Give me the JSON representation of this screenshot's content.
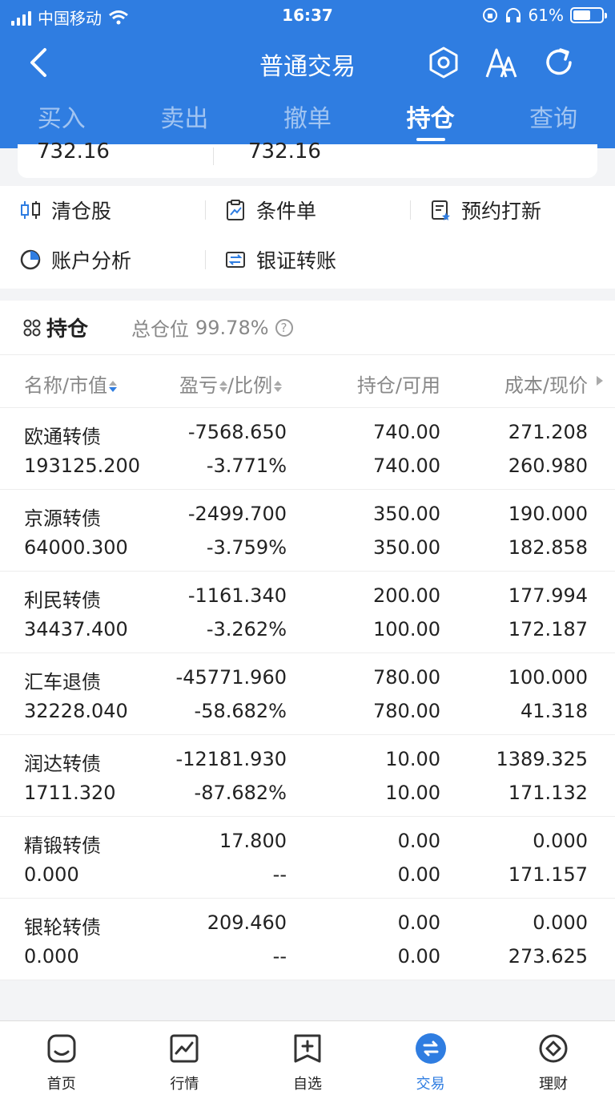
{
  "status": {
    "carrier": "中国移动",
    "time": "16:37",
    "battery": "61%",
    "battery_level": 0.61
  },
  "nav": {
    "title": "普通交易"
  },
  "tabs": [
    {
      "label": "买入"
    },
    {
      "label": "卖出"
    },
    {
      "label": "撤单"
    },
    {
      "label": "持仓",
      "active": true
    },
    {
      "label": "查询"
    }
  ],
  "summary": {
    "left_value": "732.16",
    "right_value": "732.16"
  },
  "quick_actions": [
    "清仓股",
    "条件单",
    "预约打新",
    "账户分析",
    "银证转账"
  ],
  "holdings": {
    "title": "持仓",
    "total_label": "总仓位",
    "total_value": "99.78%",
    "columns": {
      "name": "名称/市值",
      "pl": "盈亏",
      "pl_ratio": "/比例",
      "qty": "持仓/可用",
      "cost": "成本/现价"
    },
    "rows": [
      {
        "name": "欧通转债",
        "market_value": "193125.200",
        "pl": "-7568.650",
        "pl_ratio": "-3.771%",
        "position": "740.00",
        "available": "740.00",
        "cost": "271.208",
        "price": "260.980",
        "sign": "neg"
      },
      {
        "name": "京源转债",
        "market_value": "64000.300",
        "pl": "-2499.700",
        "pl_ratio": "-3.759%",
        "position": "350.00",
        "available": "350.00",
        "cost": "190.000",
        "price": "182.858",
        "sign": "neg"
      },
      {
        "name": "利民转债",
        "market_value": "34437.400",
        "pl": "-1161.340",
        "pl_ratio": "-3.262%",
        "position": "200.00",
        "available": "100.00",
        "cost": "177.994",
        "price": "172.187",
        "sign": "neg"
      },
      {
        "name": "汇车退债",
        "market_value": "32228.040",
        "pl": "-45771.960",
        "pl_ratio": "-58.682%",
        "position": "780.00",
        "available": "780.00",
        "cost": "100.000",
        "price": "41.318",
        "sign": "neg"
      },
      {
        "name": "润达转债",
        "market_value": "1711.320",
        "pl": "-12181.930",
        "pl_ratio": "-87.682%",
        "position": "10.00",
        "available": "10.00",
        "cost": "1389.325",
        "price": "171.132",
        "sign": "neg"
      },
      {
        "name": "精锻转债",
        "market_value": "0.000",
        "pl": "17.800",
        "pl_ratio": "--",
        "position": "0.00",
        "available": "0.00",
        "cost": "0.000",
        "price": "171.157",
        "sign": "pos"
      },
      {
        "name": "银轮转债",
        "market_value": "0.000",
        "pl": "209.460",
        "pl_ratio": "--",
        "position": "0.00",
        "available": "0.00",
        "cost": "0.000",
        "price": "273.625",
        "sign": "pos"
      }
    ]
  },
  "bottom_nav": [
    {
      "label": "首页",
      "icon": "home-icon"
    },
    {
      "label": "行情",
      "icon": "market-chart-icon"
    },
    {
      "label": "自选",
      "icon": "watchlist-add-icon"
    },
    {
      "label": "交易",
      "icon": "trade-exchange-icon",
      "active": true
    },
    {
      "label": "理财",
      "icon": "wealth-icon"
    }
  ],
  "colors": {
    "brand_blue": "#2f7de1",
    "loss_green": "#1fa84a",
    "gain_red": "#e8232c"
  }
}
